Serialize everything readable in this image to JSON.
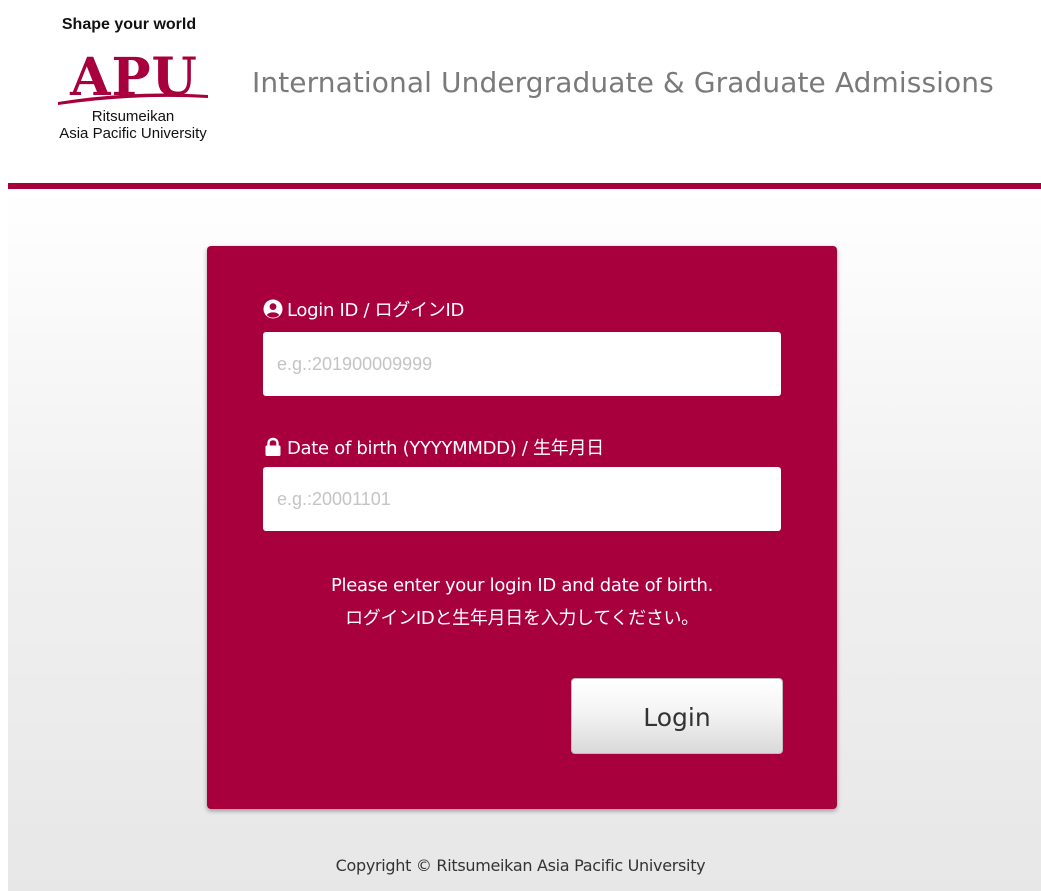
{
  "header": {
    "tagline": "Shape your world",
    "logo_text": "APU",
    "university_line1": "Ritsumeikan",
    "university_line2": "Asia Pacific University",
    "title": "International Undergraduate & Graduate Admissions"
  },
  "form": {
    "login_id": {
      "label": "Login ID / ログインID",
      "icon": "user-circle-icon",
      "value": "",
      "placeholder": "e.g.:201900009999"
    },
    "dob": {
      "label": "Date of birth (YYYYMMDD) / 生年月日",
      "icon": "lock-icon",
      "value": "",
      "placeholder": "e.g.:20001101"
    },
    "message_en": "Please enter your login ID and date of birth.",
    "message_ja": "ログインIDと生年月日を入力してください。",
    "login_button": "Login"
  },
  "footer": {
    "copyright": "Copyright © Ritsumeikan Asia Pacific University"
  },
  "colors": {
    "brand": "#a8003c",
    "header_title": "#7a7a7a"
  }
}
